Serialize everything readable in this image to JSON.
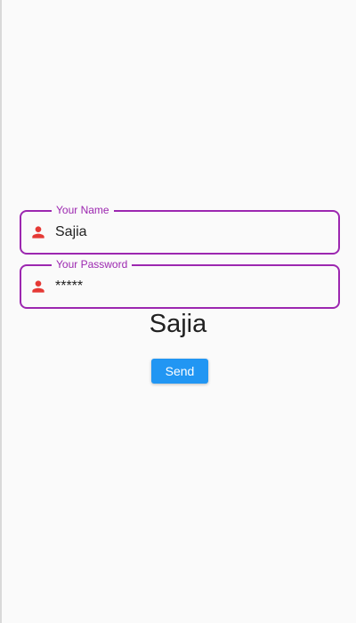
{
  "form": {
    "name_field": {
      "label": "Your Name",
      "value": "Sajia",
      "icon": "person-icon"
    },
    "password_field": {
      "label": "Your Password",
      "value": "*****",
      "icon": "person-icon"
    }
  },
  "display_text": "Sajia",
  "send_button": {
    "label": "Send"
  },
  "colors": {
    "background": "#fafafa",
    "field_border": "#9c27b0",
    "icon": "#e53935",
    "button": "#2196f3",
    "button_text": "#ffffff",
    "text": "#212121"
  }
}
